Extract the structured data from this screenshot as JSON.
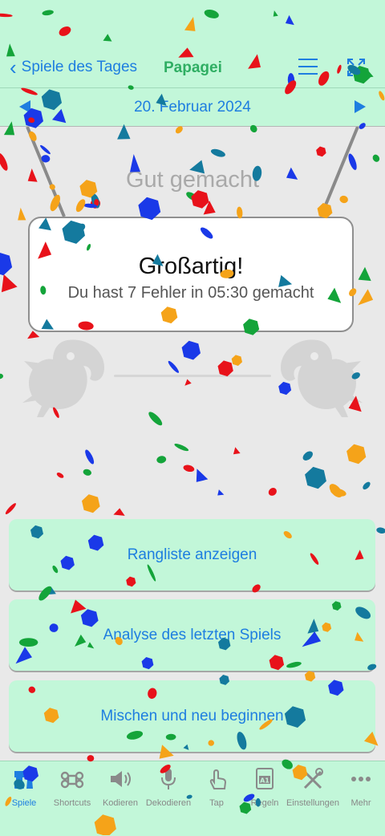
{
  "header": {
    "back_label": "Spiele des Tages",
    "title": "Papagei",
    "date": "20. Februar 2024"
  },
  "result": {
    "subtitle": "Gut gemacht",
    "title": "Großartig!",
    "message": "Du hast 7 Fehler in 05:30 gemacht"
  },
  "actions": [
    {
      "label": "Rangliste anzeigen"
    },
    {
      "label": "Analyse des letzten Spiels"
    },
    {
      "label": "Mischen und neu beginnen"
    }
  ],
  "tabbar": {
    "items": [
      {
        "label": "Spiele",
        "icon": "chess-pieces-icon",
        "active": true
      },
      {
        "label": "Shortcuts",
        "icon": "command-key-icon"
      },
      {
        "label": "Kodieren",
        "icon": "speaker-icon"
      },
      {
        "label": "Dekodieren",
        "icon": "microphone-icon"
      },
      {
        "label": "Tap",
        "icon": "tap-hand-icon"
      },
      {
        "label": "Regeln",
        "icon": "rules-a1-icon"
      },
      {
        "label": "Einstellungen",
        "icon": "tools-icon"
      },
      {
        "label": "Mehr",
        "icon": "more-dots-icon"
      }
    ]
  },
  "colors": {
    "accent": "#1e7ee0",
    "title_green": "#2fae63",
    "bar_background": "#c2f7d9",
    "page_background": "#e9e9e9"
  }
}
